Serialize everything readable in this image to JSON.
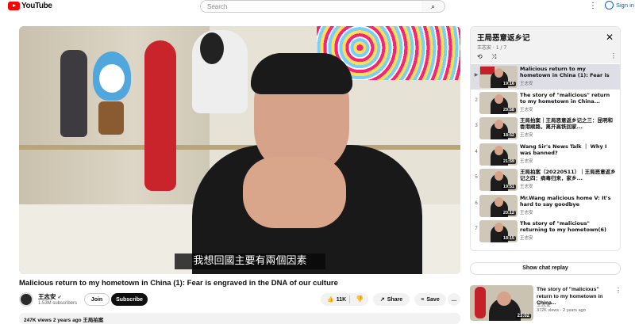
{
  "header": {
    "logo_text": "YouTube",
    "search_placeholder": "Search",
    "search_icon": "search-icon",
    "more_icon": "kebab-icon",
    "signin_label": "Sign in"
  },
  "player": {
    "subtitle": "我想回國主要有兩個因素"
  },
  "video": {
    "title": "Malicious return to my hometown in China (1):  Fear is engraved in the DNA of our culture",
    "channel": "王志安",
    "subscribers": "1.53M subscribers",
    "join_label": "Join",
    "subscribe_label": "Subscribe",
    "likes": "11K",
    "share_label": "Share",
    "save_label": "Save",
    "description_meta": "247K views  2 years ago  王局拍案"
  },
  "playlist": {
    "title": "王局恶意返乡记",
    "meta": "王志安 · 1 / 7",
    "items": [
      {
        "index": "▶",
        "title": "Malicious return to my hometown in China (1):  Fear is engraved i...",
        "channel": "王志安",
        "duration": "19:16",
        "current": true
      },
      {
        "index": "2",
        "title": "The story of \"malicious\" return to my hometown in China...",
        "channel": "王志安",
        "duration": "29:58",
        "current": false
      },
      {
        "index": "3",
        "title": "王局拍案｜王局恶意返乡记之三：昆明和香港顺路，离开高铁回家...",
        "channel": "王志安",
        "duration": "18:52",
        "current": false
      },
      {
        "index": "4",
        "title": "Wang Sir's News Talk ｜ Why I was banned?",
        "channel": "王志安",
        "duration": "21:59",
        "current": false
      },
      {
        "index": "5",
        "title": "王局拍案（20220511）｜王局恶意返乡记之四：病毒归来，家乡...",
        "channel": "王志安",
        "duration": "19:51",
        "current": false
      },
      {
        "index": "6",
        "title": "Mr.Wang malicious home V: It's hard to say goodbye",
        "channel": "王志安",
        "duration": "20:12",
        "current": false
      },
      {
        "index": "7",
        "title": "The story of \"malicious\" returning to my hometown(6)",
        "channel": "王志安",
        "duration": "18:15",
        "current": false
      }
    ]
  },
  "chat_replay_label": "Show chat replay",
  "recommendation": {
    "title": "The story of \"malicious\" return to my hometown in China...",
    "channel": "王志安",
    "meta": "372K views · 2 years ago",
    "duration": "23:02"
  }
}
